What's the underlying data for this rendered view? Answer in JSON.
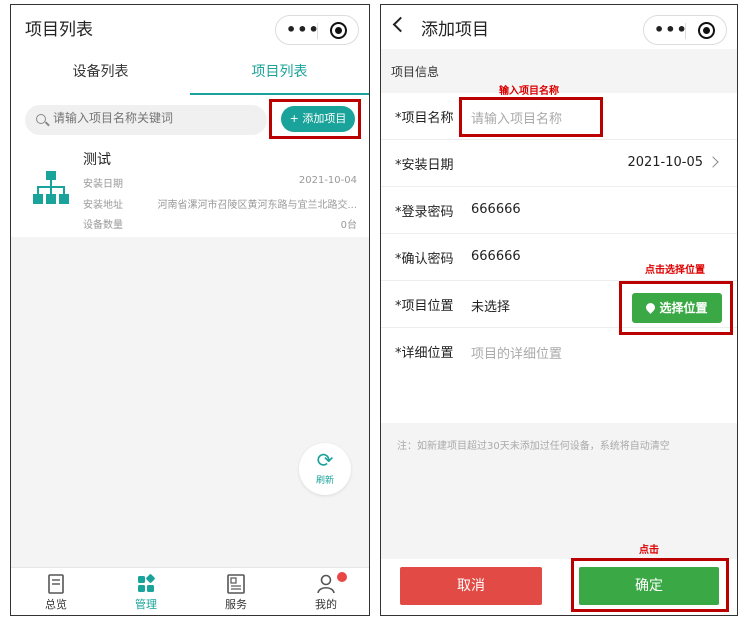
{
  "left": {
    "title": "项目列表",
    "tabs": [
      "设备列表",
      "项目列表"
    ],
    "search_placeholder": "请输入项目名称关键词",
    "add_button": "添加项目",
    "project": {
      "name": "测试",
      "rows": [
        {
          "label": "安装日期",
          "value": "2021-10-04"
        },
        {
          "label": "安装地址",
          "value": "河南省漯河市召陵区黄河东路与宜兰北路交..."
        },
        {
          "label": "设备数量",
          "value": "0台"
        }
      ]
    },
    "refresh_label": "刷新",
    "tabbar": [
      "总览",
      "管理",
      "服务",
      "我的"
    ],
    "accent": "#1aa39a"
  },
  "right": {
    "title": "添加项目",
    "section": "项目信息",
    "fields": [
      {
        "label": "*项目名称",
        "placeholder": "请输入项目名称"
      },
      {
        "label": "*安装日期",
        "value": "2021-10-05"
      },
      {
        "label": "*登录密码",
        "value": "666666"
      },
      {
        "label": "*确认密码",
        "value": "666666"
      },
      {
        "label": "*项目位置",
        "value": "未选择"
      },
      {
        "label": "*详细位置",
        "placeholder": "项目的详细位置"
      }
    ],
    "location_button": "选择位置",
    "note": "注：如新建项目超过30天未添加过任何设备，系统将自动清空",
    "cancel": "取消",
    "confirm": "确定",
    "annotations": {
      "name_hint": "输入项目名称",
      "location_hint": "点击选择位置",
      "confirm_hint": "点击"
    },
    "green": "#3aa845",
    "red": "#e24a45"
  }
}
